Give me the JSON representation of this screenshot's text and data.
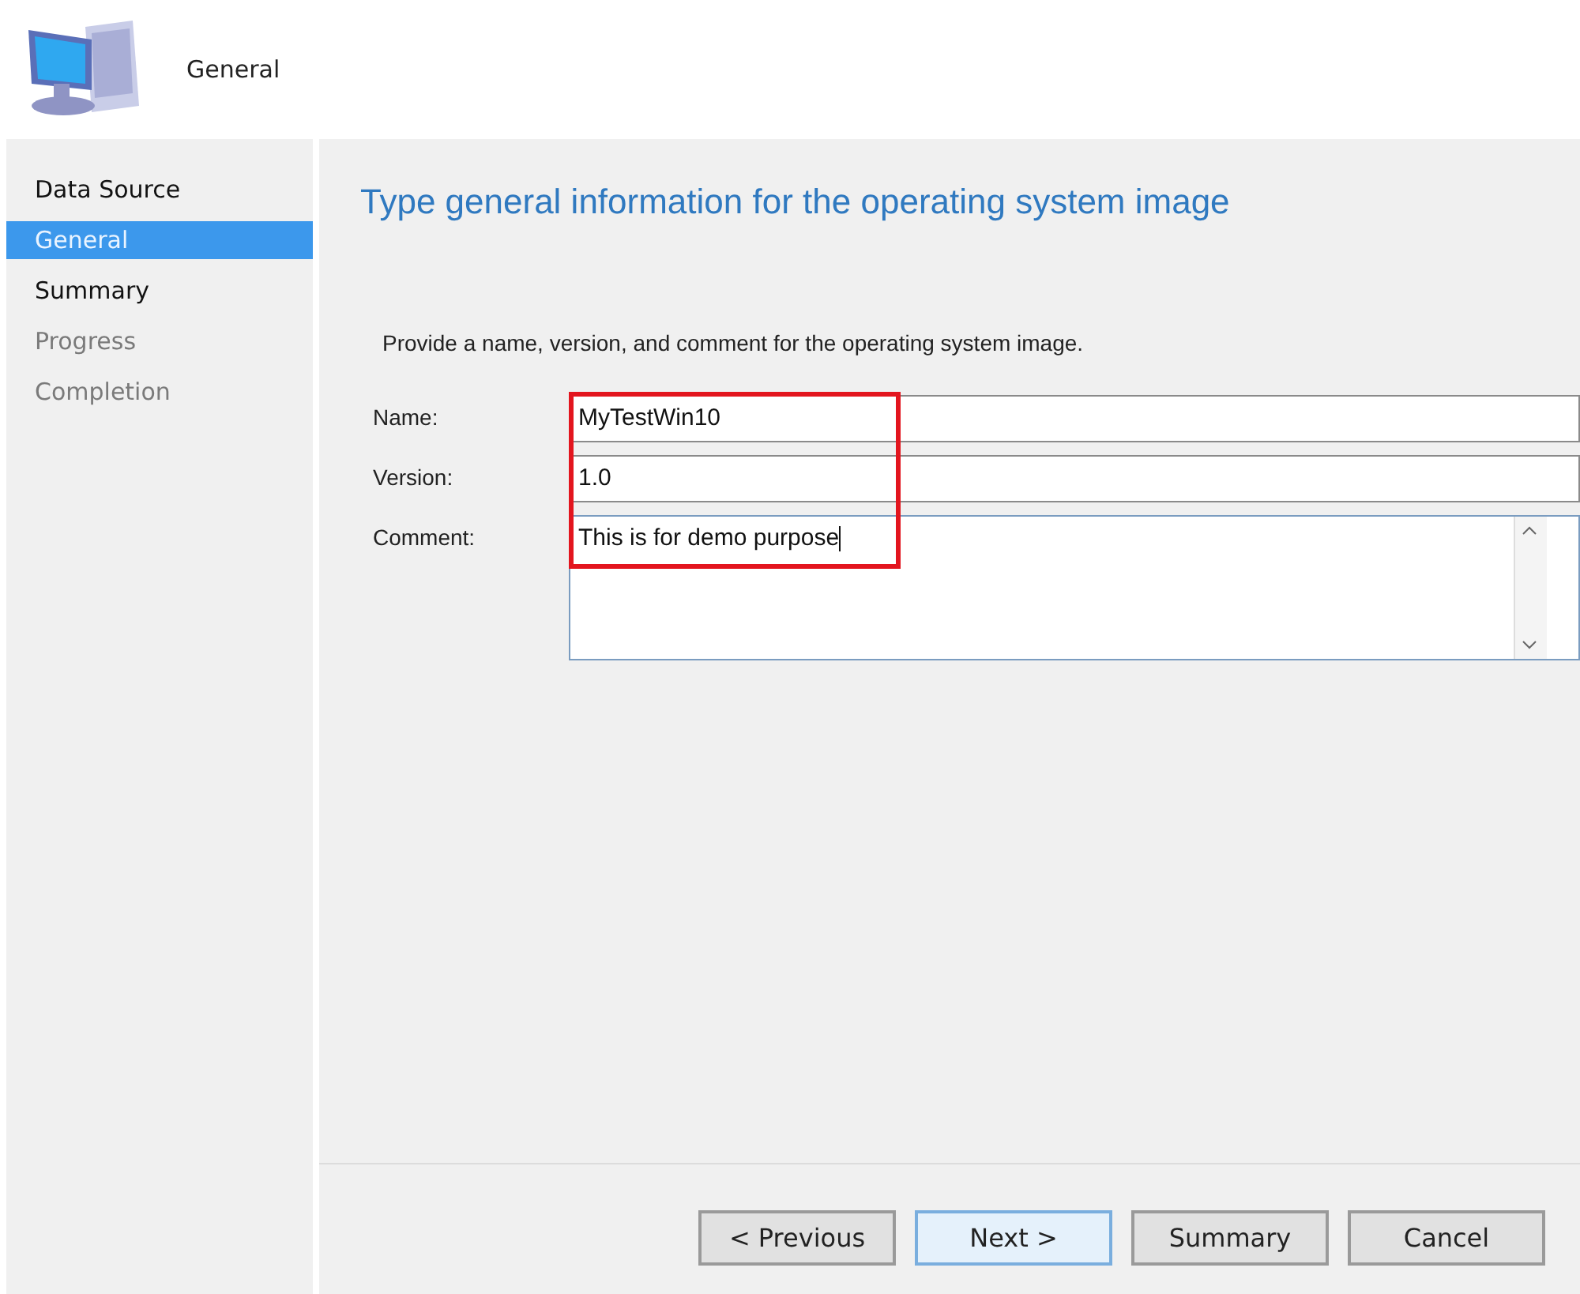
{
  "header": {
    "title": "General"
  },
  "sidebar": {
    "items": [
      {
        "label": "Data Source",
        "selected": false,
        "disabled": false
      },
      {
        "label": "General",
        "selected": true,
        "disabled": false
      },
      {
        "label": "Summary",
        "selected": false,
        "disabled": false
      },
      {
        "label": "Progress",
        "selected": false,
        "disabled": true
      },
      {
        "label": "Completion",
        "selected": false,
        "disabled": true
      }
    ]
  },
  "page": {
    "heading": "Type general information for the operating system image",
    "description": "Provide a name, version, and comment for the operating system image.",
    "fields": [
      {
        "kind": "text",
        "label": "Name:",
        "value": "MyTestWin10"
      },
      {
        "kind": "text",
        "label": "Version:",
        "value": "1.0"
      },
      {
        "kind": "multiline",
        "label": "Comment:",
        "value": "This is for demo purpose"
      }
    ]
  },
  "buttons": [
    {
      "label": "< Previous",
      "focused": false
    },
    {
      "label": "Next >",
      "focused": true
    },
    {
      "label": "Summary",
      "focused": false
    },
    {
      "label": "Cancel",
      "focused": false
    }
  ]
}
